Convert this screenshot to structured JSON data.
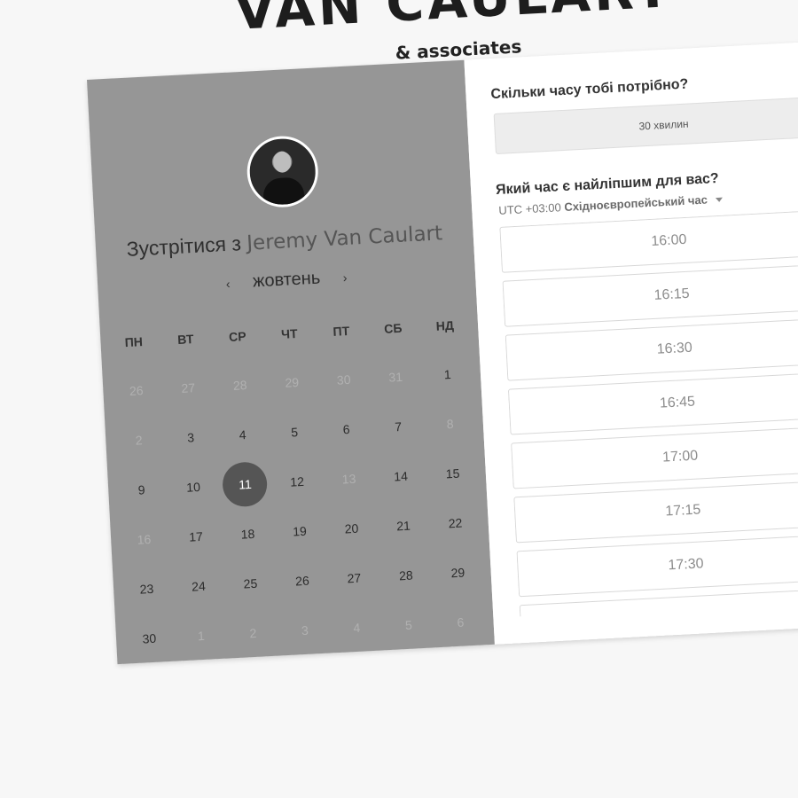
{
  "brand": {
    "title": "VAN CAULART",
    "subtitle": "& associates"
  },
  "profile": {
    "meet_prefix": "Зустрітися з",
    "name": "Jeremy Van Caulart"
  },
  "calendar": {
    "month": "жовтень",
    "prev": "‹",
    "next": "›",
    "weekdays": [
      "ПН",
      "ВТ",
      "СР",
      "ЧТ",
      "ПТ",
      "СБ",
      "НД"
    ],
    "weeks": [
      [
        "26",
        "27",
        "28",
        "29",
        "30",
        "31",
        "1"
      ],
      [
        "2",
        "3",
        "4",
        "5",
        "6",
        "7",
        "8"
      ],
      [
        "9",
        "10",
        "11",
        "12",
        "13",
        "14",
        "15"
      ],
      [
        "16",
        "17",
        "18",
        "19",
        "20",
        "21",
        "22"
      ],
      [
        "23",
        "24",
        "25",
        "26",
        "27",
        "28",
        "29"
      ],
      [
        "30",
        "1",
        "2",
        "3",
        "4",
        "5",
        "6"
      ]
    ],
    "selected": "11"
  },
  "booking": {
    "duration_question": "Скільки часу тобі потрібно?",
    "duration_value": "30 хвилин",
    "time_question": "Який час є найліпшим для вас?",
    "timezone_offset": "UTC +03:00",
    "timezone_name": "Східноєвропейський час",
    "slots": [
      "16:00",
      "16:15",
      "16:30",
      "16:45",
      "17:00",
      "17:15",
      "17:30",
      ""
    ]
  }
}
